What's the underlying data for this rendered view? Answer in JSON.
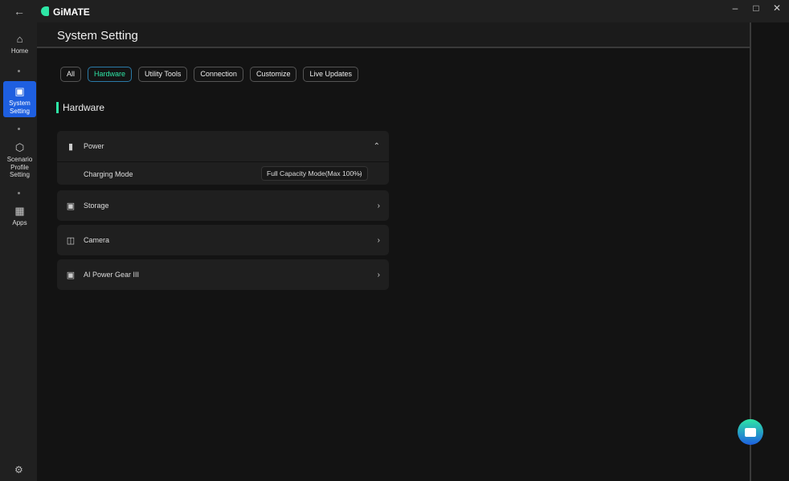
{
  "app": {
    "name": "GiMATE"
  },
  "sidebar": {
    "items": [
      {
        "label": "Home"
      },
      {
        "label": "System Setting"
      },
      {
        "label": "Scenario Profile Setting"
      },
      {
        "label": "Apps"
      }
    ]
  },
  "header": {
    "title": "System Setting"
  },
  "tabs": [
    {
      "label": "All"
    },
    {
      "label": "Hardware"
    },
    {
      "label": "Utility Tools"
    },
    {
      "label": "Connection"
    },
    {
      "label": "Customize"
    },
    {
      "label": "Live Updates"
    }
  ],
  "section": {
    "title": "Hardware"
  },
  "cards": {
    "power": {
      "label": "Power",
      "charging_label": "Charging Mode",
      "charging_value": "Full Capacity Mode(Max 100%)"
    },
    "storage": {
      "label": "Storage"
    },
    "camera": {
      "label": "Camera"
    },
    "ai": {
      "label": "AI Power Gear III"
    }
  },
  "colors": {
    "accent": "#2ee6a6",
    "active": "#1e5fe0"
  }
}
